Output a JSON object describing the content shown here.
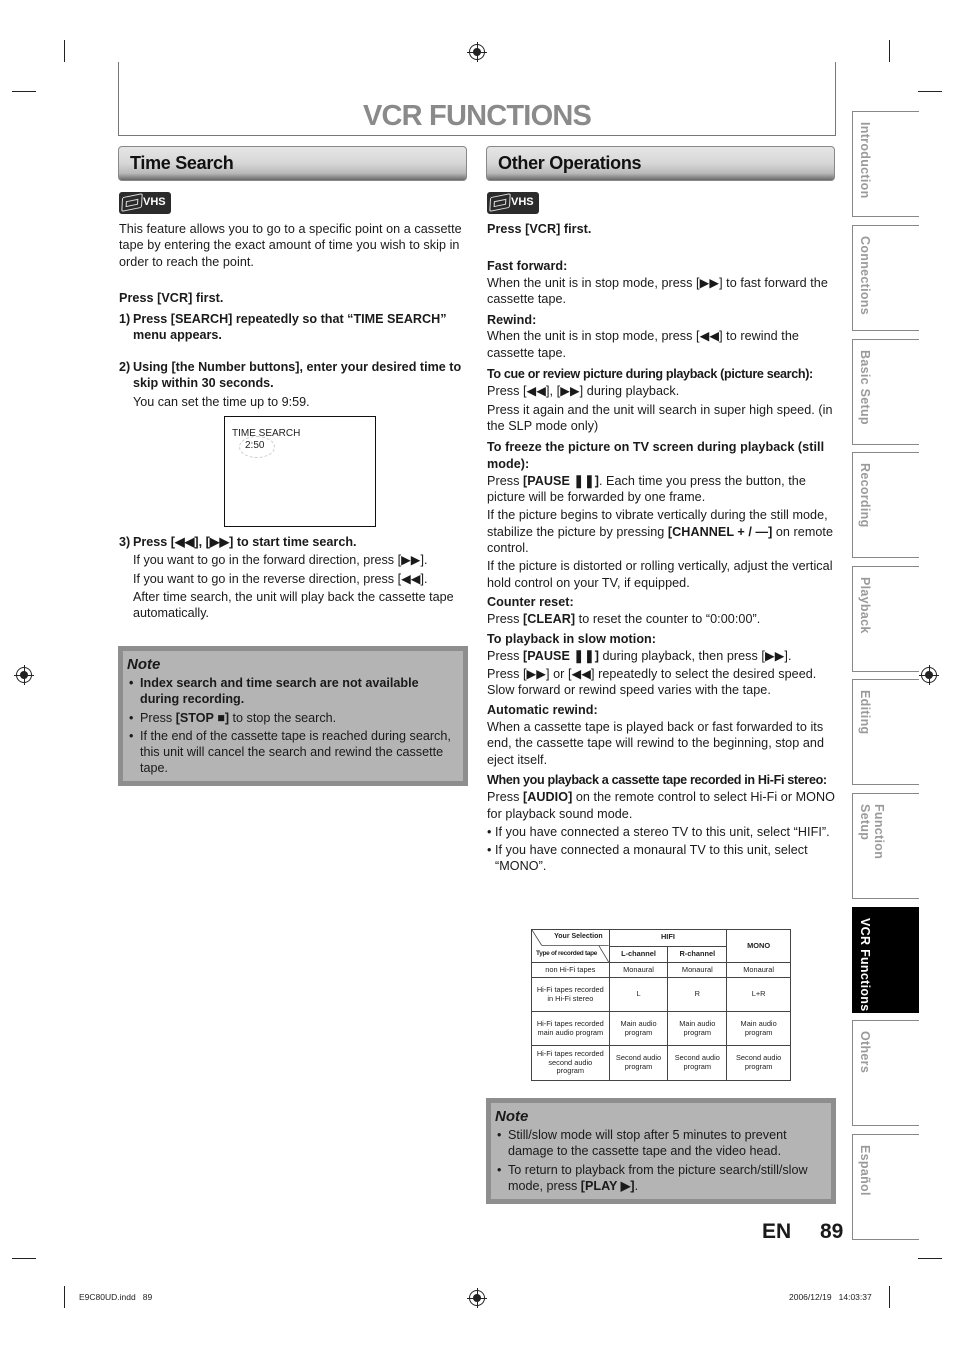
{
  "header": {
    "title": "VCR FUNCTIONS"
  },
  "time_search": {
    "heading": "Time Search",
    "badge": "VHS",
    "intro": "This feature allows you to go to a specific point on a cassette tape by entering the exact amount of time you wish to skip in order to reach the point.",
    "press_first": "Press [VCR] first.",
    "steps": [
      {
        "num": "1)",
        "text": "Press [SEARCH] repeatedly so that “TIME SEARCH” menu appears."
      },
      {
        "num": "2)",
        "text": "Using [the Number buttons], enter your desired time to skip within 30 seconds.",
        "sub": "You can set the time up to 9:59."
      },
      {
        "num": "3)",
        "text": "Press [◀◀], [▶▶] to start time search.",
        "sub_lines": [
          "If you want to go in the forward direction, press [▶▶].",
          "If you want to go in the reverse direction, press [◀◀].",
          "After time search, the unit will play back the cassette tape automatically."
        ]
      }
    ],
    "osd": {
      "title": "TIME SEARCH",
      "time": "2:50"
    },
    "note": {
      "title": "Note",
      "items": [
        {
          "text": "Index search and time search are not available during recording.",
          "bold": true
        },
        {
          "pre": "Press ",
          "key": "[STOP ■]",
          "post": " to stop the search."
        },
        {
          "text": "If the end of the cassette tape is reached during search, this unit will cancel the search and rewind the cassette tape."
        }
      ]
    }
  },
  "other_operations": {
    "heading": "Other Operations",
    "badge": "VHS",
    "press_first": "Press [VCR] first.",
    "fast_forward": {
      "title": "Fast forward:",
      "text": "When the unit is in stop mode, press [▶▶] to fast forward the cassette tape."
    },
    "rewind": {
      "title": "Rewind:",
      "text": "When the unit is in stop mode, press [◀◀] to rewind the cassette tape."
    },
    "picture_search": {
      "title": "To cue or review picture during playback (picture search):",
      "line1": "Press [◀◀], [▶▶] during playback.",
      "line2": "Press it again and the unit will search in super high speed. (in the SLP mode only)"
    },
    "still_mode": {
      "title": "To freeze the picture on TV screen during playback (still mode):",
      "p1_pre": "Press ",
      "p1_key": "[PAUSE ❚❚]",
      "p1_post": ". Each time you press the button, the picture will be forwarded by one frame.",
      "p2_pre": "If the picture begins to vibrate vertically during the still mode, stabilize the picture by pressing ",
      "p2_key": "[CHANNEL + / —]",
      "p2_post": " on remote control.",
      "p3": "If the picture is distorted or rolling vertically, adjust the vertical hold control on your TV, if equipped."
    },
    "counter_reset": {
      "title": "Counter reset:",
      "pre": "Press ",
      "key": "[CLEAR]",
      "post": " to reset the counter to “0:00:00”."
    },
    "slow_motion": {
      "title": "To playback in slow motion:",
      "p1_pre": "Press ",
      "p1_key": "[PAUSE ❚❚]",
      "p1_post": " during playback, then press [▶▶].",
      "p2": "Press [▶▶] or [◀◀] repeatedly to select the desired speed. Slow forward or rewind speed varies with the tape."
    },
    "auto_rewind": {
      "title": "Automatic rewind:",
      "text": "When a cassette tape is played back or fast forwarded to its end, the cassette tape will rewind to the beginning, stop and eject itself."
    },
    "hifi": {
      "title": "When you playback a cassette tape recorded in Hi-Fi stereo:",
      "pre": "Press ",
      "key": "[AUDIO]",
      "post": " on the remote control to select Hi-Fi or MONO for playback sound mode.",
      "bullets": [
        "If you have connected a stereo TV to this unit, select “HIFI”.",
        "If you have connected a monaural TV to this unit, select “MONO”."
      ]
    },
    "table": {
      "corner_top": "Your Selection",
      "corner_bottom": "Type of recorded tape",
      "group_header": "HIFI",
      "mono_header": "MONO",
      "sub_headers": [
        "L-channel",
        "R-channel"
      ],
      "rows": [
        {
          "type": "non Hi-Fi tapes",
          "cells": [
            "Monaural",
            "Monaural",
            "Monaural"
          ]
        },
        {
          "type": "Hi-Fi tapes recorded in Hi-Fi stereo",
          "cells": [
            "L",
            "R",
            "L+R"
          ]
        },
        {
          "type": "Hi-Fi tapes recorded main audio program",
          "cells": [
            "Main audio program",
            "Main audio program",
            "Main audio program"
          ]
        },
        {
          "type": "Hi-Fi tapes recorded second audio program",
          "cells": [
            "Second audio program",
            "Second audio program",
            "Second audio program"
          ]
        }
      ]
    },
    "note": {
      "title": "Note",
      "items": [
        {
          "text": "Still/slow mode will stop after 5 minutes to prevent damage to the cassette tape and the video head."
        },
        {
          "pre": "To return to playback from the picture search/still/slow mode, press ",
          "key": "[PLAY ▶]",
          "post": "."
        }
      ]
    }
  },
  "side_tabs": [
    {
      "label": "Introduction",
      "active": false
    },
    {
      "label": "Connections",
      "active": false
    },
    {
      "label": "Basic Setup",
      "active": false
    },
    {
      "label": "Recording",
      "active": false
    },
    {
      "label": "Playback",
      "active": false
    },
    {
      "label": "Editing",
      "active": false
    },
    {
      "label": "Function Setup",
      "active": false
    },
    {
      "label": "VCR Functions",
      "active": true
    },
    {
      "label": "Others",
      "active": false
    },
    {
      "label": "Español",
      "active": false
    }
  ],
  "page": {
    "lang": "EN",
    "number": "89"
  },
  "footer": {
    "file": "E9C80UD.indd   89",
    "datetime": "2006/12/19   14:03:37"
  }
}
